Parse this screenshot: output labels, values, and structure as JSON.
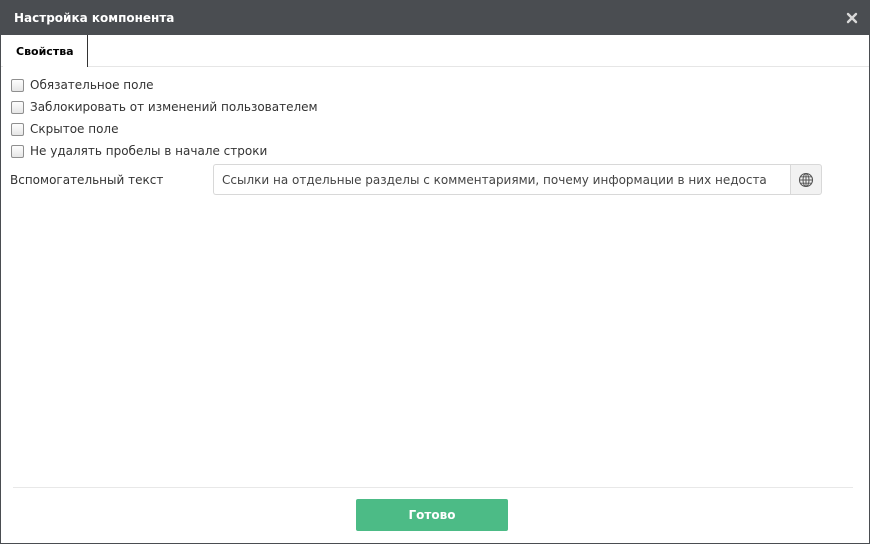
{
  "dialog": {
    "title": "Настройка компонента"
  },
  "tabs": [
    {
      "label": "Свойства",
      "active": true
    }
  ],
  "checkboxes": [
    {
      "label": "Обязательное поле",
      "checked": false
    },
    {
      "label": "Заблокировать от изменений пользователем",
      "checked": false
    },
    {
      "label": "Скрытое поле",
      "checked": false
    },
    {
      "label": "Не удалять пробелы в начале строки",
      "checked": false
    }
  ],
  "helper_text": {
    "label": "Вспомогательный текст",
    "value": "Ссылки на отдельные разделы с комментариями, почему информации в них недоста"
  },
  "footer": {
    "done_label": "Готово"
  },
  "colors": {
    "titlebar": "#4a4d51",
    "done_button": "#4cbb86"
  },
  "icons": {
    "close": "close-icon",
    "globe": "globe-icon"
  }
}
